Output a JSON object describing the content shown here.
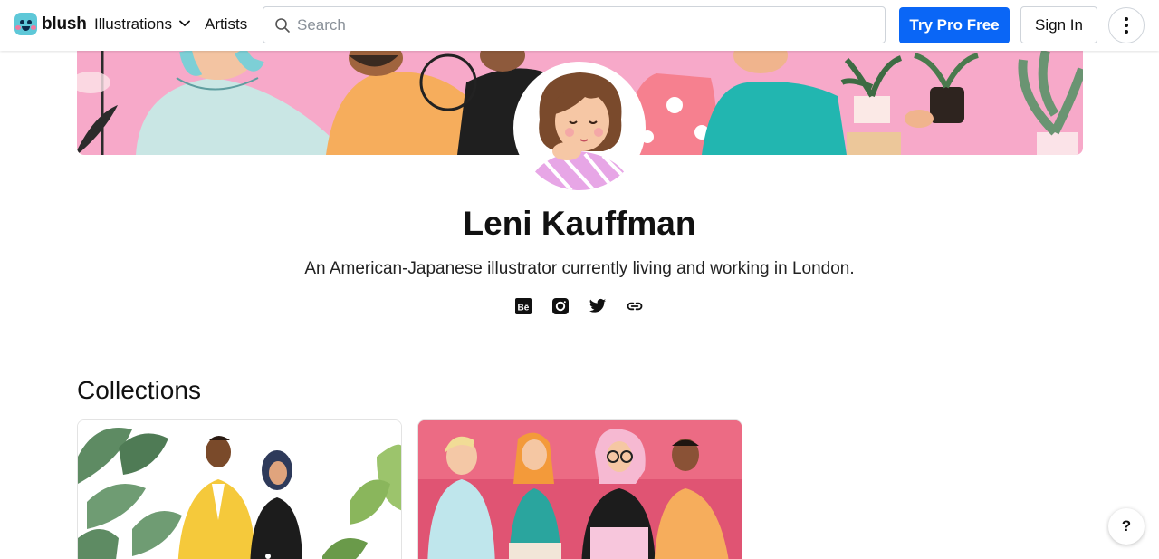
{
  "header": {
    "logo_text": "blush",
    "nav_illustrations": "Illustrations",
    "nav_artists": "Artists",
    "search": {
      "placeholder": "Search",
      "value": ""
    },
    "try_pro_label": "Try Pro Free",
    "sign_in_label": "Sign In"
  },
  "profile": {
    "name": "Leni Kauffman",
    "bio": "An American-Japanese illustrator currently living and working in London.",
    "socials": [
      "behance-icon",
      "instagram-icon",
      "twitter-icon",
      "link-icon"
    ]
  },
  "collections": {
    "title": "Collections",
    "cards": [
      {
        "name": "collection-card-plants"
      },
      {
        "name": "collection-card-friends"
      }
    ]
  },
  "help_label": "?",
  "colors": {
    "accent": "#0a66f6",
    "banner_pink": "#f7a9c9",
    "card_pink": "#ec6b84"
  }
}
